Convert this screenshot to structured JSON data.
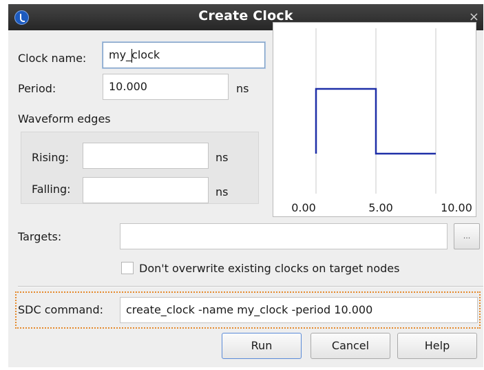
{
  "window": {
    "title": "Create Clock",
    "close_glyph": "×",
    "accent": "#1d5bbf"
  },
  "form": {
    "clock_name_label": "Clock name:",
    "clock_name_value_pre": "my_",
    "clock_name_value_post": "clock",
    "period_label": "Period:",
    "period_value": "10.000",
    "period_unit": "ns",
    "waveform_edges_label": "Waveform edges",
    "rising_label": "Rising:",
    "rising_value": "",
    "rising_unit": "ns",
    "falling_label": "Falling:",
    "falling_value": "",
    "falling_unit": "ns",
    "targets_label": "Targets:",
    "targets_value": "",
    "browse_label": "...",
    "dont_overwrite_label": "Don't overwrite existing clocks on target nodes",
    "dont_overwrite_checked": false,
    "sdc_label": "SDC command:",
    "sdc_value": "create_clock -name my_clock -period 10.000"
  },
  "waveform": {
    "x_ticks": [
      "0.00",
      "5.00",
      "10.00"
    ],
    "color": "#1f2fa8",
    "chart_data": {
      "type": "line",
      "x": [
        0,
        0,
        5,
        5,
        10
      ],
      "y": [
        0,
        1,
        1,
        0,
        0
      ],
      "xlim": [
        0,
        10
      ]
    }
  },
  "buttons": {
    "run": "Run",
    "cancel": "Cancel",
    "help": "Help"
  },
  "highlight_color": "#e5892a"
}
